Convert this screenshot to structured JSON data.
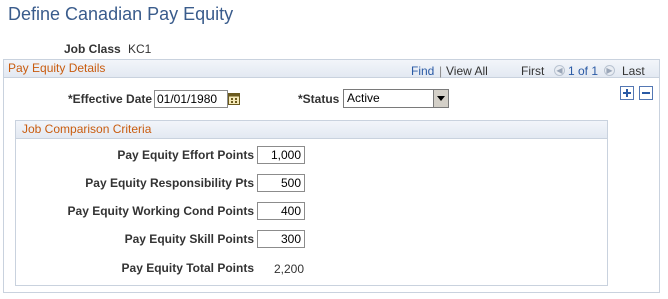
{
  "page": {
    "title": "Define Canadian Pay Equity"
  },
  "job_class": {
    "label": "Job Class",
    "value": "KC1"
  },
  "details": {
    "title": "Pay Equity Details",
    "nav": {
      "find": "Find",
      "separator": "|",
      "view_all": "View All",
      "first": "First",
      "prev_icon": "previous-arrow",
      "position": "1 of 1",
      "next_icon": "next-arrow",
      "last": "Last"
    },
    "effective_date": {
      "label": "*Effective Date",
      "value": "01/01/1980"
    },
    "status": {
      "label": "*Status",
      "value": "Active"
    }
  },
  "criteria": {
    "title": "Job Comparison Criteria",
    "effort": {
      "label": "Pay Equity Effort Points",
      "value": "1,000"
    },
    "responsibility": {
      "label": "Pay Equity Responsibility Pts",
      "value": "500"
    },
    "working_cond": {
      "label": "Pay Equity Working Cond Points",
      "value": "400"
    },
    "skill": {
      "label": "Pay Equity Skill Points",
      "value": "300"
    },
    "total": {
      "label": "Pay Equity Total Points",
      "value": "2,200"
    }
  },
  "colors": {
    "title": "#3a5c8c",
    "section_title": "#c95c0f",
    "link": "#2a5aa5",
    "border": "#c9d2de"
  }
}
